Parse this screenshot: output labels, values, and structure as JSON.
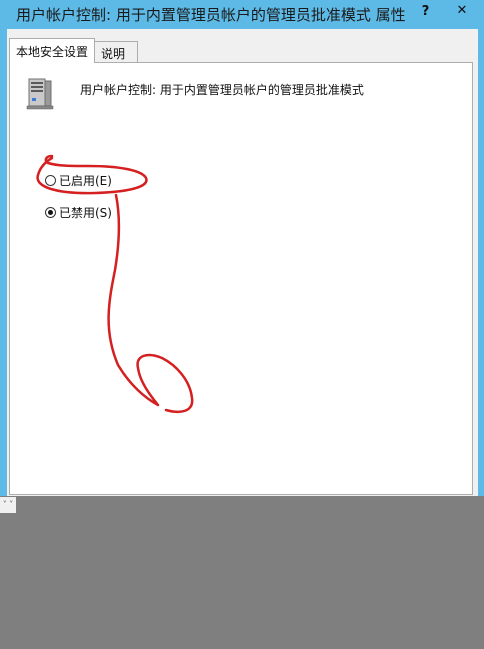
{
  "window": {
    "title": "用户帐户控制: 用于内置管理员帐户的管理员批准模式 属性",
    "help_label": "?",
    "close_label": "✕"
  },
  "tabs": [
    {
      "label": "本地安全设置",
      "active": true
    },
    {
      "label": "说明",
      "active": false
    }
  ],
  "policy": {
    "icon": "server-icon",
    "name": "用户帐户控制: 用于内置管理员帐户的管理员批准模式"
  },
  "options": [
    {
      "label": "已启用(E)",
      "checked": false
    },
    {
      "label": "已禁用(S)",
      "checked": true
    }
  ],
  "resize_mark": "˅ ˅",
  "annotation": {
    "color": "#d42020",
    "icon": "hand-drawn-arrow"
  }
}
